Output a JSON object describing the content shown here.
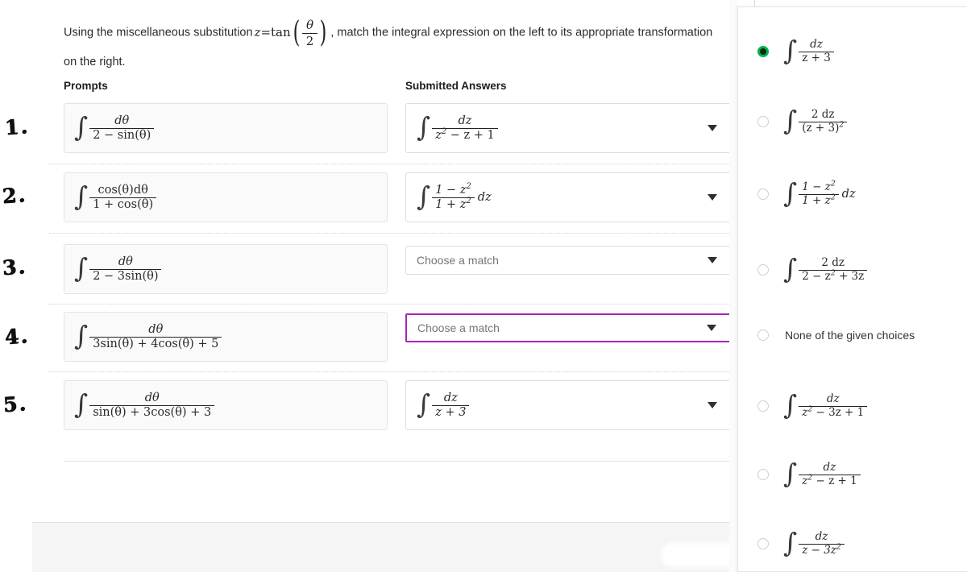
{
  "question": {
    "text_before": "Using the miscellaneous substitution",
    "substitution": {
      "lhs": "z",
      "equals": "=",
      "fn": "tan",
      "num": "θ",
      "den": "2"
    },
    "text_after": ", match the integral expression on the left to its appropriate transformation on the right."
  },
  "columns": {
    "prompts_header": "Prompts",
    "answers_header": "Submitted Answers"
  },
  "margin_marks": [
    "1.",
    "2.",
    "3.",
    "4.",
    "5."
  ],
  "rows": [
    {
      "index": 1,
      "prompt": {
        "integral": "∫",
        "num": "dθ",
        "den": "2 − sin(θ)",
        "trail": ""
      },
      "answer": {
        "type": "value",
        "integral": "∫",
        "num": "dz",
        "den_pre": "z",
        "den_sup": "2",
        "den_post": " − z + 1",
        "trail": ""
      }
    },
    {
      "index": 2,
      "prompt": {
        "integral": "∫",
        "num": "cos(θ)dθ",
        "den": "1 + cos(θ)",
        "trail": ""
      },
      "answer": {
        "type": "value",
        "integral": "∫",
        "num_pre": "1 − z",
        "num_sup": "2",
        "den_pre": "1 + z",
        "den_sup": "2",
        "trail": "dz"
      }
    },
    {
      "index": 3,
      "prompt": {
        "integral": "∫",
        "num": "dθ",
        "den": "2 − 3sin(θ)",
        "trail": ""
      },
      "answer": {
        "type": "placeholder",
        "placeholder": "Choose a match"
      }
    },
    {
      "index": 4,
      "prompt": {
        "integral": "∫",
        "num": "dθ",
        "den": "3sin(θ) + 4cos(θ) + 5",
        "trail": ""
      },
      "answer": {
        "type": "placeholder",
        "placeholder": "Choose a match",
        "focused": true
      }
    },
    {
      "index": 5,
      "prompt": {
        "integral": "∫",
        "num": "dθ",
        "den": "sin(θ) + 3cos(θ) + 3",
        "trail": ""
      },
      "answer": {
        "type": "value",
        "integral": "∫",
        "num": "dz",
        "den_pre": "z + 3",
        "trail": ""
      }
    }
  ],
  "dropdown": {
    "options": [
      {
        "id": "opt-1",
        "selected": true,
        "kind": "frac",
        "num": "dz",
        "den_pre": "z + 3",
        "den_sup": "",
        "den_post": "",
        "trail": ""
      },
      {
        "id": "opt-2",
        "selected": false,
        "kind": "frac",
        "num": "2 dz",
        "den_pre": "(z + 3)",
        "den_sup": "2",
        "den_post": "",
        "trail": ""
      },
      {
        "id": "opt-3",
        "selected": false,
        "kind": "frac2sup",
        "num_pre": "1 − z",
        "num_sup": "2",
        "den_pre": "1 + z",
        "den_sup": "2",
        "trail": "dz"
      },
      {
        "id": "opt-4",
        "selected": false,
        "kind": "frac",
        "num": "2 dz",
        "den_pre": "2 − z",
        "den_sup": "2",
        "den_post": " + 3z",
        "trail": ""
      },
      {
        "id": "opt-5",
        "selected": false,
        "kind": "text",
        "label": "None of the given choices"
      },
      {
        "id": "opt-6",
        "selected": false,
        "kind": "frac",
        "num": "dz",
        "den_pre": "z",
        "den_sup": "2",
        "den_post": " − 3z + 1",
        "trail": ""
      },
      {
        "id": "opt-7",
        "selected": false,
        "kind": "frac",
        "num": "dz",
        "den_pre": "z",
        "den_sup": "2",
        "den_post": " − z + 1",
        "trail": ""
      },
      {
        "id": "opt-8",
        "selected": false,
        "kind": "frac",
        "num": "dz",
        "den_pre": "z − 3z",
        "den_sup": "2",
        "den_post": "",
        "trail": ""
      }
    ]
  },
  "colors": {
    "focus_border": "#A626B8",
    "radio_selected": "#00b44a",
    "prompt_bg": "#fafafa",
    "footer_bg": "#f5f5f5"
  }
}
